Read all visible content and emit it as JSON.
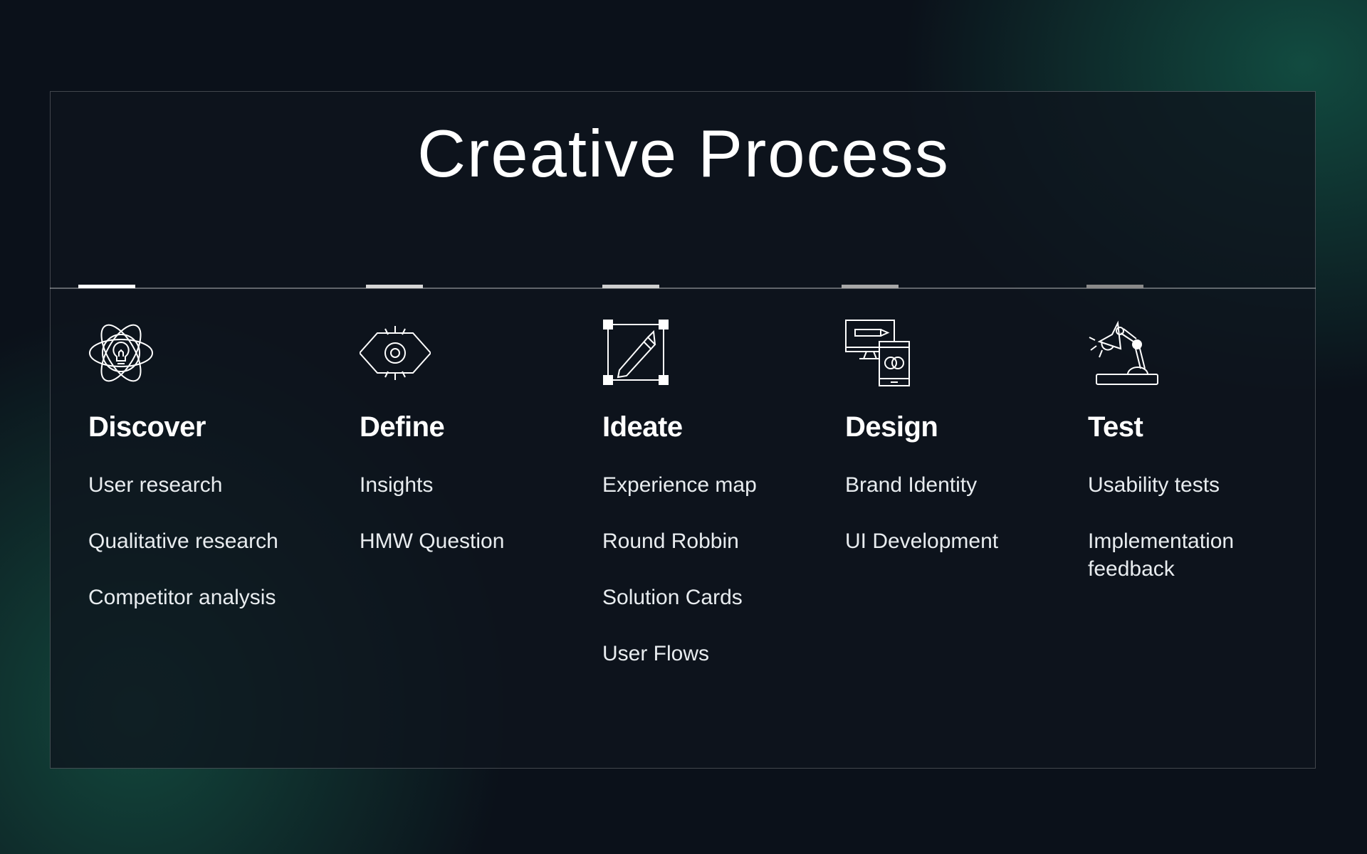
{
  "title": "Creative Process",
  "colors": {
    "background": "#0b111a",
    "accent_gradient": "#124e42",
    "text": "#ffffff"
  },
  "steps": [
    {
      "title": "Discover",
      "icon": "atom-lightbulb-icon",
      "marker_color": "#ffffff",
      "items": [
        "User research",
        "Qualitative research",
        "Competitor analysis"
      ]
    },
    {
      "title": "Define",
      "icon": "eye-icon",
      "marker_color": "#d6d6d6",
      "items": [
        "Insights",
        "HMW Question"
      ]
    },
    {
      "title": "Ideate",
      "icon": "pencil-artboard-icon",
      "marker_color": "#cfcfcf",
      "items": [
        "Experience map",
        "Round Robbin",
        "Solution Cards",
        "User Flows"
      ]
    },
    {
      "title": "Design",
      "icon": "devices-icon",
      "marker_color": "#a8a8a8",
      "items": [
        "Brand Identity",
        "UI Development"
      ]
    },
    {
      "title": "Test",
      "icon": "desk-lamp-icon",
      "marker_color": "#8a8a8a",
      "items": [
        "Usability tests",
        "Implementation feedback"
      ]
    }
  ]
}
